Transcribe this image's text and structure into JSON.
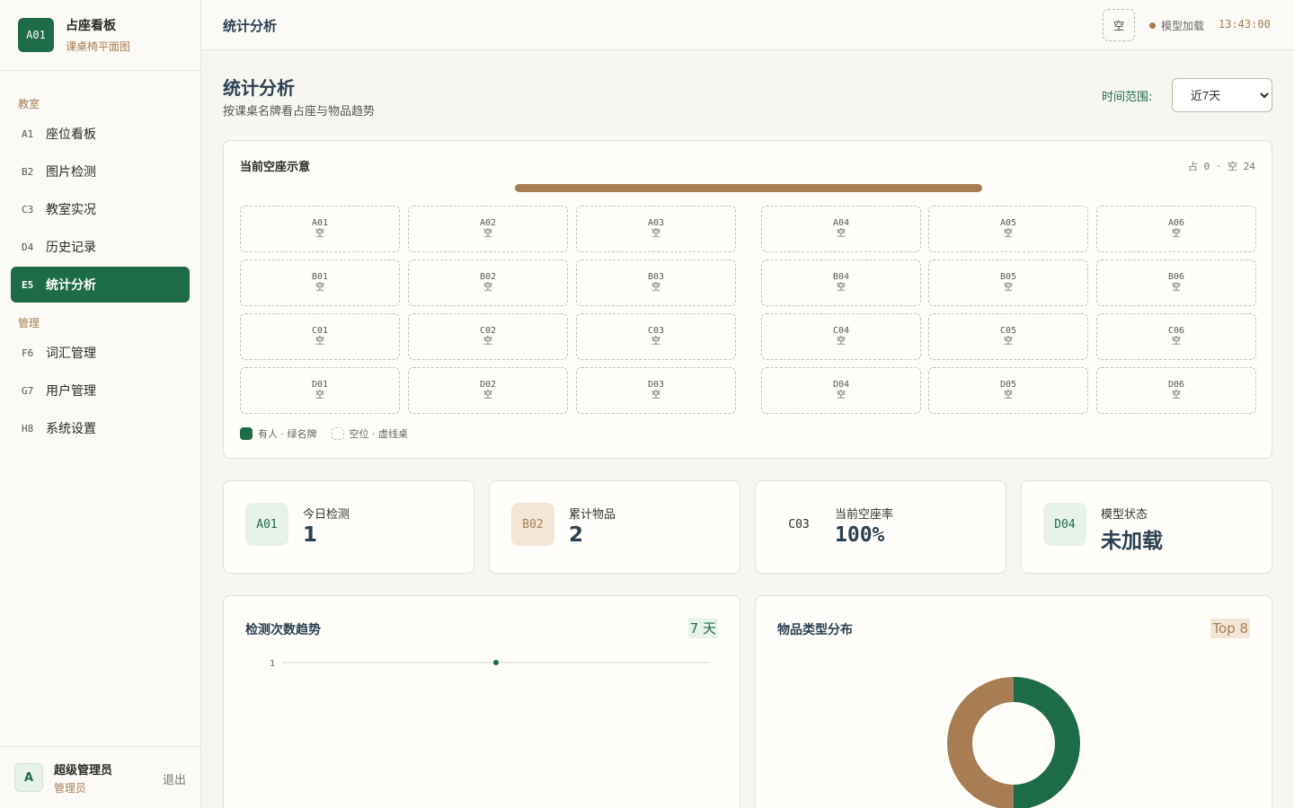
{
  "brand": {
    "badge": "A01",
    "title": "占座看板",
    "subtitle": "课桌椅平面图"
  },
  "nav": {
    "section_classroom": "教室",
    "section_admin": "管理",
    "items": [
      {
        "code": "A1",
        "label": "座位看板"
      },
      {
        "code": "B2",
        "label": "图片检测"
      },
      {
        "code": "C3",
        "label": "教室实况"
      },
      {
        "code": "D4",
        "label": "历史记录"
      },
      {
        "code": "E5",
        "label": "统计分析",
        "active": true
      },
      {
        "code": "F6",
        "label": "词汇管理"
      },
      {
        "code": "G7",
        "label": "用户管理"
      },
      {
        "code": "H8",
        "label": "系统设置"
      }
    ]
  },
  "user": {
    "avatar": "A",
    "name": "超级管理员",
    "role": "管理员",
    "logout": "退出"
  },
  "topbar": {
    "title": "统计分析",
    "button_label": "空",
    "model_status": "模型加载",
    "clock": "13:43:00"
  },
  "page": {
    "title": "统计分析",
    "subtitle": "按课桌名牌看占座与物品趋势",
    "range_label": "时间范围:",
    "range_value": "近7天",
    "range_options": [
      "近7天"
    ]
  },
  "seatmap": {
    "title": "当前空座示意",
    "summary": "占 0 · 空 24",
    "seats": [
      [
        "A01",
        "A02",
        "A03",
        "A04",
        "A05",
        "A06"
      ],
      [
        "B01",
        "B02",
        "B03",
        "B04",
        "B05",
        "B06"
      ],
      [
        "C01",
        "C02",
        "C03",
        "C04",
        "C05",
        "C06"
      ],
      [
        "D01",
        "D02",
        "D03",
        "D04",
        "D05",
        "D06"
      ]
    ],
    "seat_status": "空",
    "legend_occupied": "有人 · 绿名牌",
    "legend_empty": "空位 · 虚线桌"
  },
  "stats": [
    {
      "badge": "A01",
      "label": "今日检测",
      "value": "1"
    },
    {
      "badge": "B02",
      "label": "累计物品",
      "value": "2"
    },
    {
      "badge": "C03",
      "label": "当前空座率",
      "value": "100%"
    },
    {
      "badge": "D04",
      "label": "模型状态",
      "value": "未加载"
    }
  ],
  "trend_card": {
    "title": "检测次数趋势",
    "tag": "7 天"
  },
  "dist_card": {
    "title": "物品类型分布",
    "tag": "Top 8"
  },
  "chart_data": [
    {
      "type": "line",
      "title": "检测次数趋势",
      "y_tick_labels": [
        "1"
      ],
      "series": [
        {
          "values": [
            1
          ]
        }
      ],
      "color": "#1e6b47"
    },
    {
      "type": "pie",
      "title": "物品类型分布",
      "slices": [
        {
          "value": 1,
          "color": "#1e6b47"
        },
        {
          "value": 1,
          "color": "#a87d54"
        }
      ],
      "donut": true
    }
  ]
}
